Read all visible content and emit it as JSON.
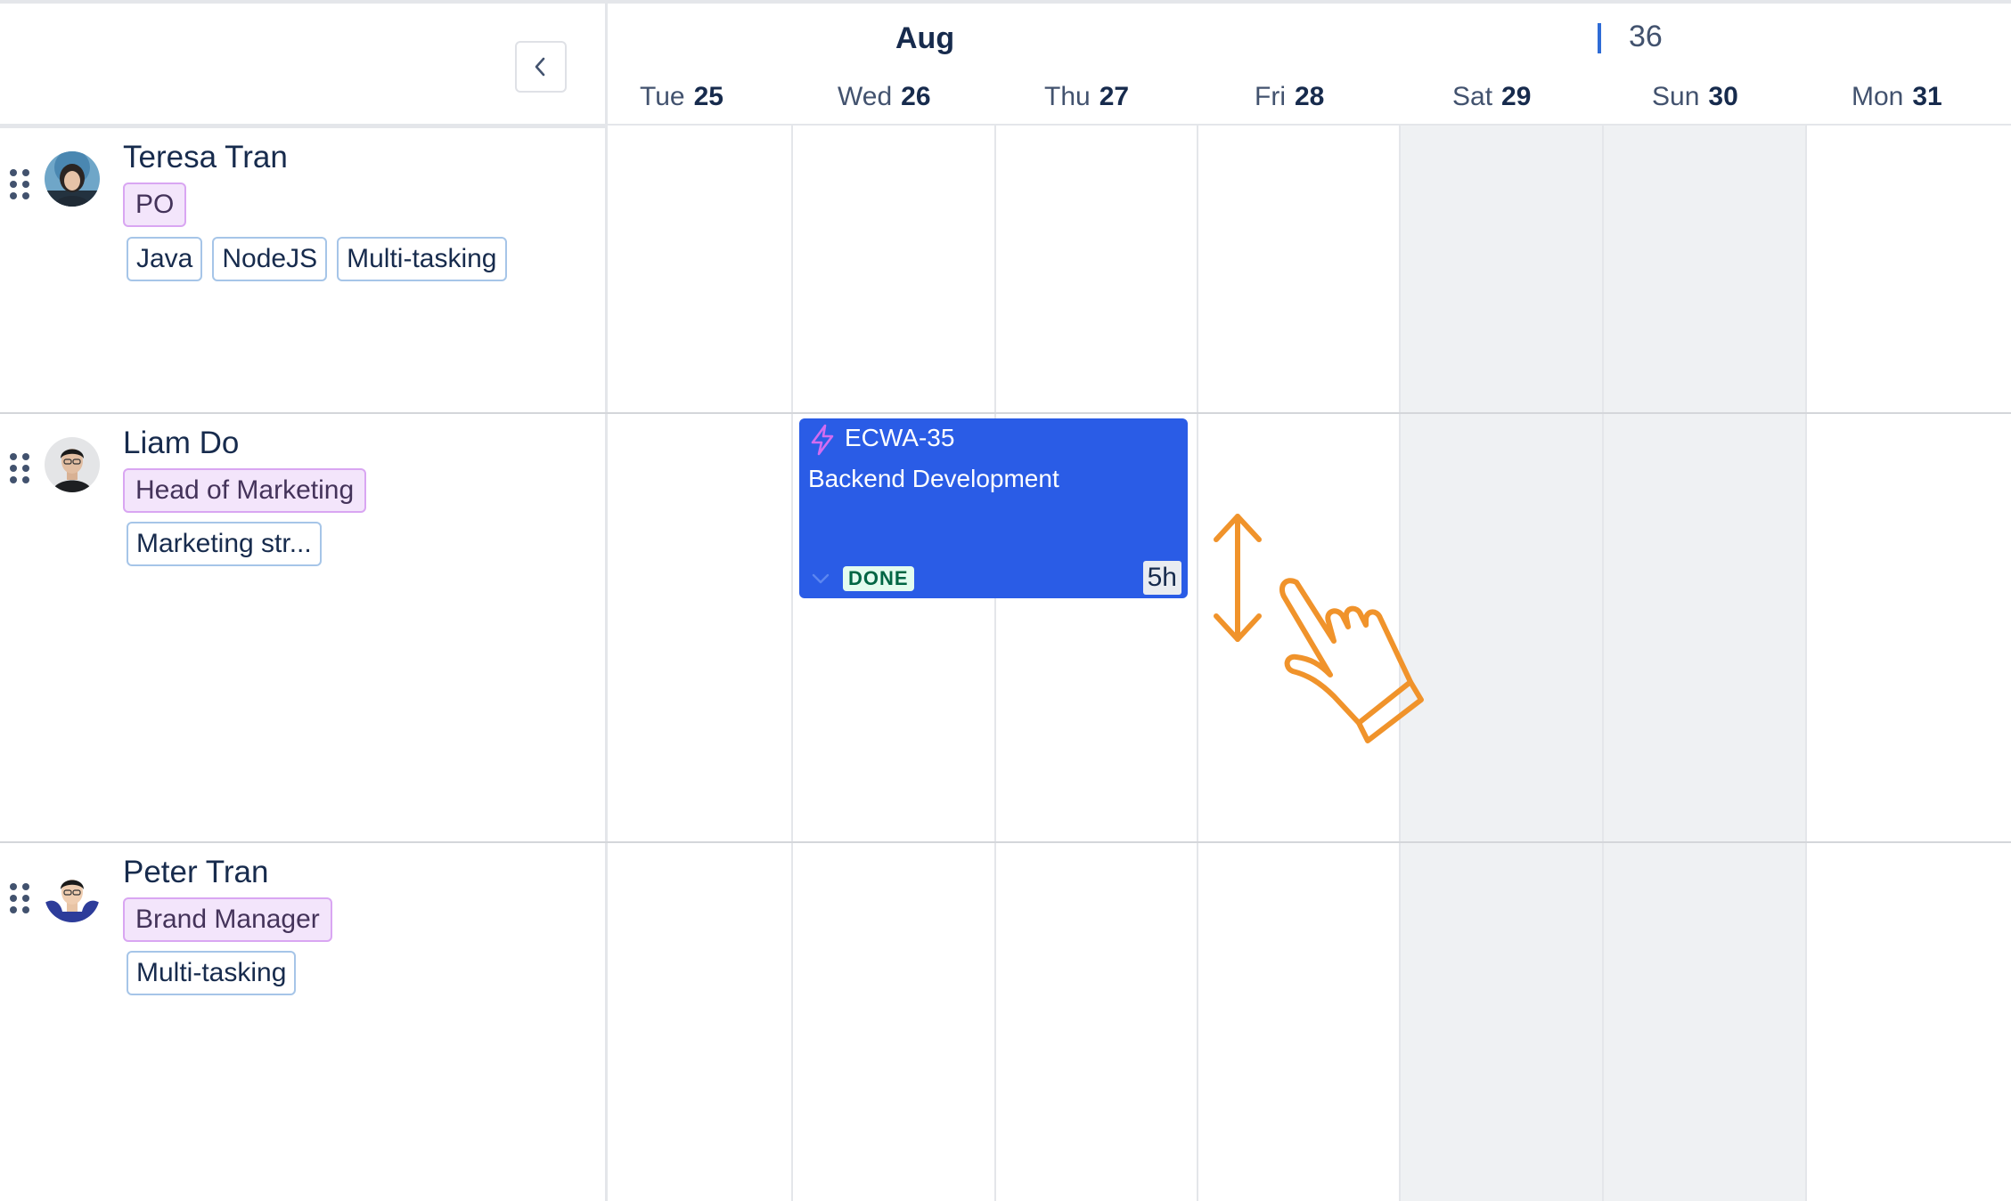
{
  "header": {
    "month": "Aug",
    "week_number": "36",
    "days": [
      {
        "name": "Tue",
        "num": "25"
      },
      {
        "name": "Wed",
        "num": "26"
      },
      {
        "name": "Thu",
        "num": "27"
      },
      {
        "name": "Fri",
        "num": "28"
      },
      {
        "name": "Sat",
        "num": "29"
      },
      {
        "name": "Sun",
        "num": "30"
      },
      {
        "name": "Mon",
        "num": "31"
      }
    ]
  },
  "resources": [
    {
      "name": "Teresa Tran",
      "role": "PO",
      "skills": [
        "Java",
        "NodeJS",
        "Multi-tasking"
      ]
    },
    {
      "name": "Liam Do",
      "role": "Head of Marketing",
      "skills": [
        "Marketing str..."
      ]
    },
    {
      "name": "Peter Tran",
      "role": "Brand Manager",
      "skills": [
        "Multi-tasking"
      ]
    }
  ],
  "task": {
    "key": "ECWA-35",
    "title": "Backend Development",
    "status": "DONE",
    "hours": "5h"
  },
  "colors": {
    "task_card": "#2a5ce6",
    "role_tag": "#f3e5fb",
    "weekend": "#eff1f3",
    "gesture": "#f0932b",
    "status_done": "#006644"
  },
  "icons": {
    "collapse": "chevron-left-icon",
    "drag": "drag-handle-icon",
    "task_type": "lightning-icon",
    "gesture": "hand-pointer-icon",
    "resize": "vertical-resize-arrow-icon"
  }
}
